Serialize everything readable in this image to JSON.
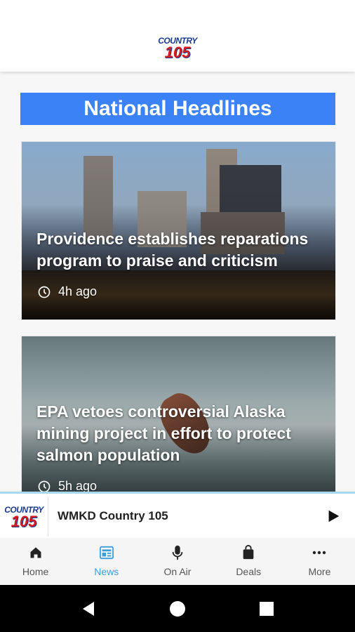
{
  "header": {
    "logo_top": "COUNTRY",
    "logo_bottom": "105"
  },
  "section": {
    "title": "National Headlines"
  },
  "articles": [
    {
      "title": "Providence establishes reparations program to praise and criticism",
      "time": "4h ago"
    },
    {
      "title": "EPA vetoes controversial Alaska mining project in effort to protect salmon population",
      "time": "5h ago"
    }
  ],
  "player": {
    "logo_top": "COUNTRY",
    "logo_bottom": "105",
    "station": "WMKD Country 105",
    "play_icon": "play-icon"
  },
  "tabs": [
    {
      "label": "Home",
      "icon": "home-icon"
    },
    {
      "label": "News",
      "icon": "news-icon"
    },
    {
      "label": "On Air",
      "icon": "microphone-icon"
    },
    {
      "label": "Deals",
      "icon": "shopping-bag-icon"
    },
    {
      "label": "More",
      "icon": "more-icon"
    }
  ],
  "colors": {
    "accent": "#3b82f6",
    "tab_active": "#3aa0dc"
  }
}
